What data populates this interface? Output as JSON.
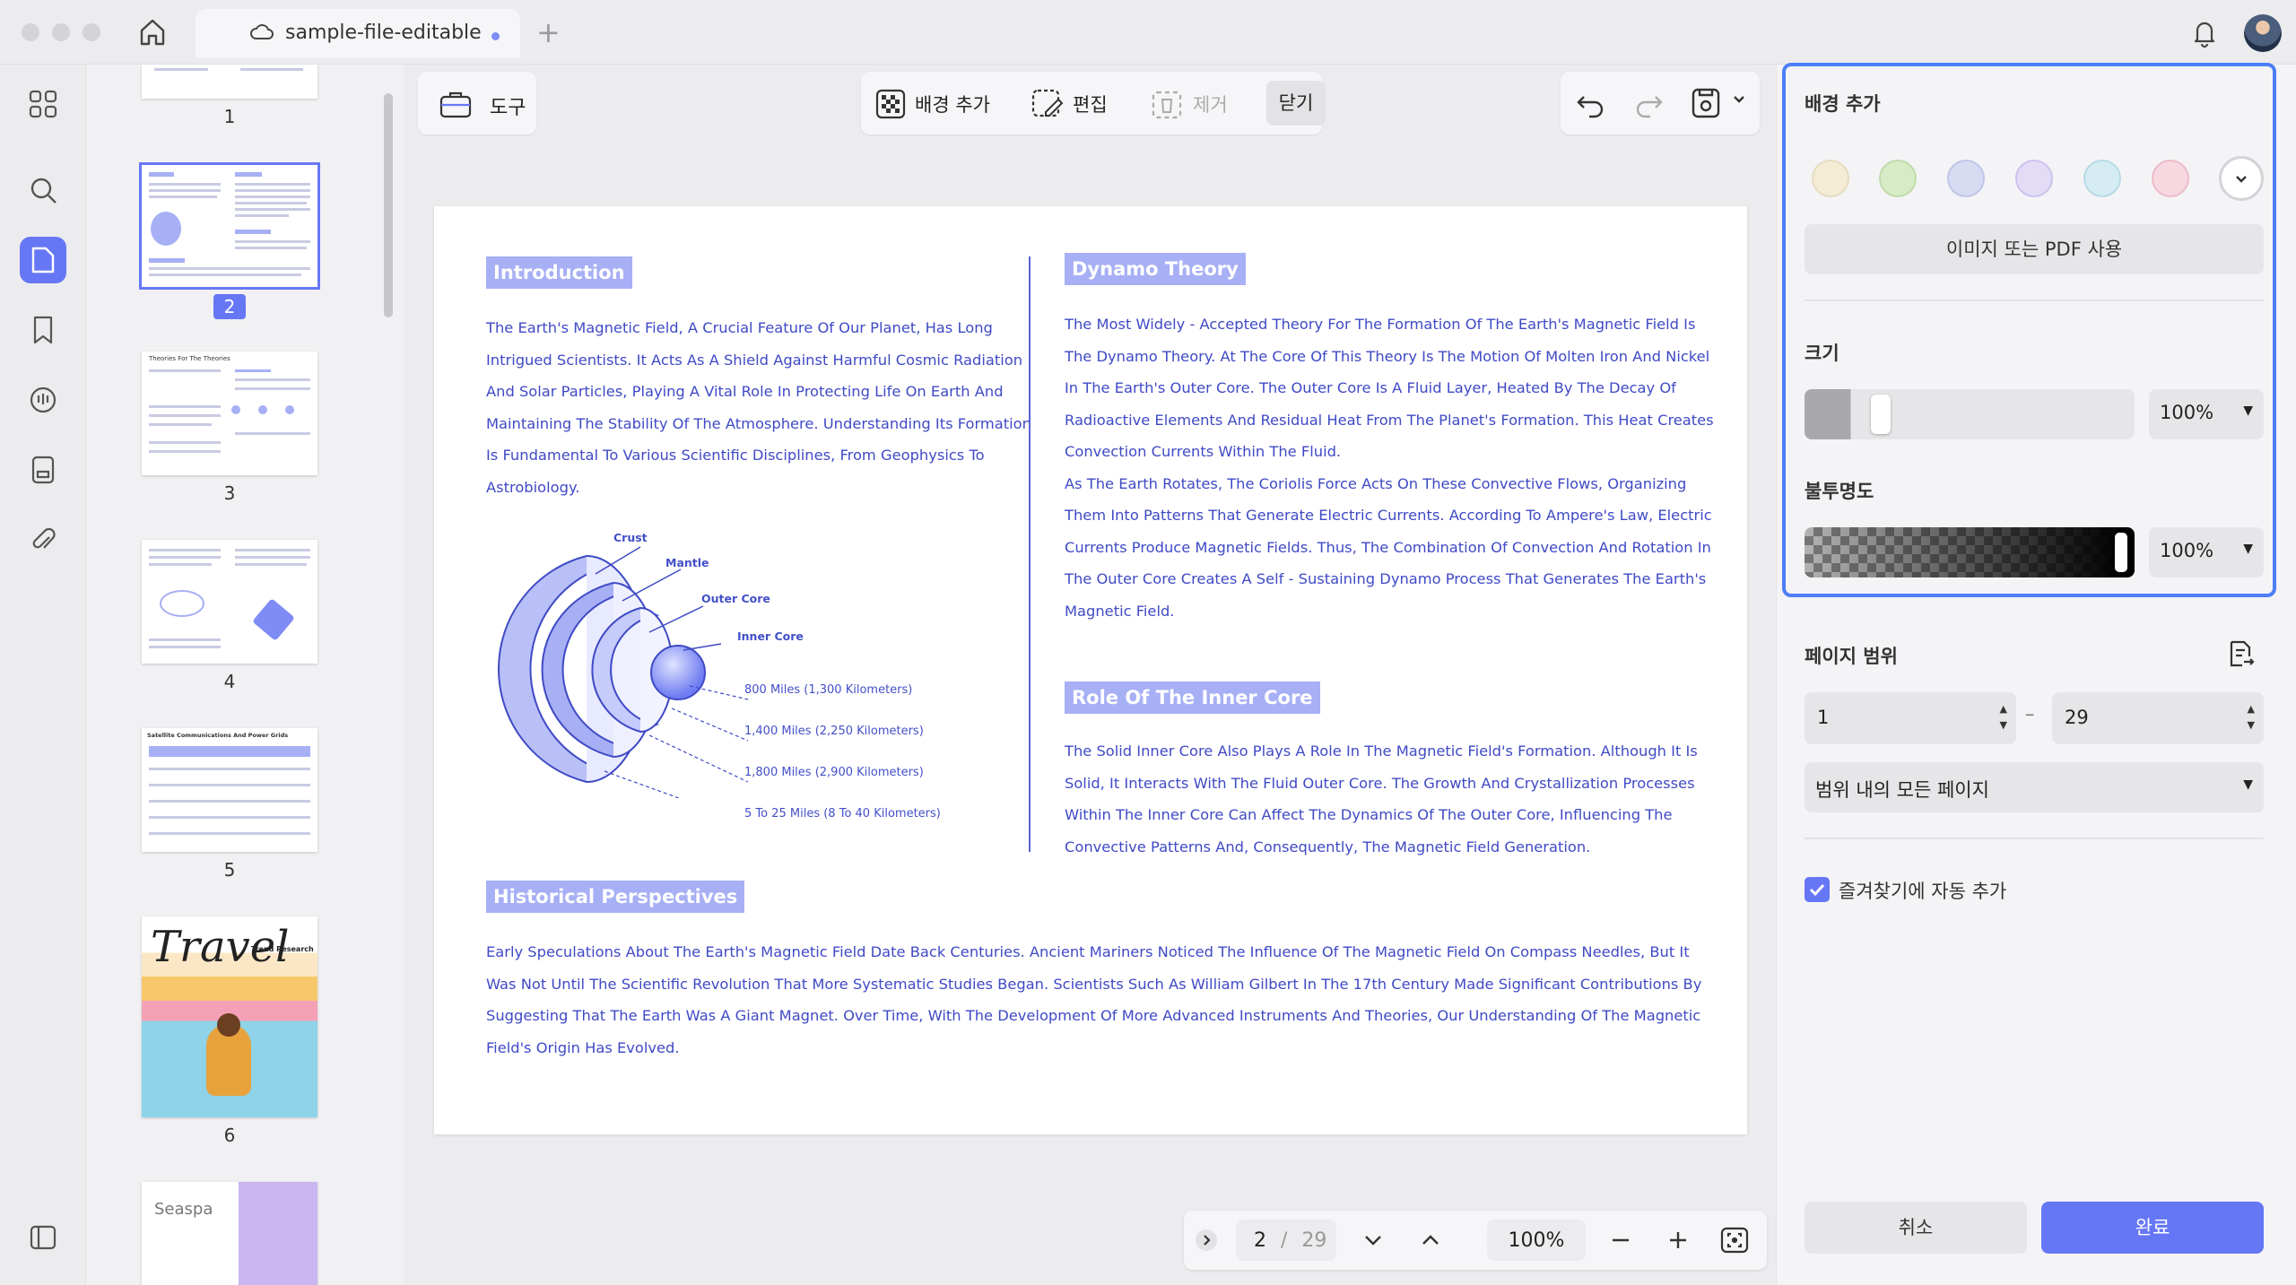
{
  "window": {
    "tab_title": "sample-file-editable",
    "new_tab_symbol": "+"
  },
  "thumbnails": {
    "pages": [
      "1",
      "2",
      "3",
      "4",
      "5",
      "6"
    ],
    "page3_title": "Theories For The Theories",
    "page5_title": "Satellite Communications And Power Grids",
    "page6_script": "Travel",
    "page6_caption": "Trend Research",
    "page7_word": "Seaspa"
  },
  "toolbar": {
    "tools_label": "도구",
    "add_background_label": "배경 추가",
    "edit_label": "편집",
    "remove_label": "제거",
    "close_label": "닫기"
  },
  "document": {
    "introduction": {
      "heading": "Introduction",
      "lines": [
        "The Earth's Magnetic Field, A Crucial Feature Of Our Planet, Has Long",
        "Intrigued Scientists. It Acts As A Shield Against Harmful Cosmic Radiation",
        "And Solar Particles, Playing A Vital Role In Protecting Life On Earth And",
        "Maintaining The Stability Of The Atmosphere. Understanding Its Formation",
        "Is Fundamental To Various Scientific Disciplines, From Geophysics To",
        "Astrobiology."
      ]
    },
    "earth_diagram": {
      "layers": [
        "Crust",
        "Mantle",
        "Outer Core",
        "Inner Core"
      ],
      "distances": [
        "800 Miles (1,300 Kilometers)",
        "1,400 Miles (2,250 Kilometers)",
        "1,800 Miles (2,900 Kilometers)",
        "5 To 25 Miles (8 To 40 Kilometers)"
      ]
    },
    "dynamo": {
      "heading": "Dynamo Theory",
      "lines": [
        "The Most Widely - Accepted Theory For The Formation Of The Earth's Magnetic Field Is",
        "The Dynamo Theory. At The Core Of This Theory Is The Motion Of Molten Iron And Nickel",
        "In The Earth's Outer Core. The Outer Core Is A Fluid Layer, Heated By The Decay Of",
        "Radioactive Elements And Residual Heat From The Planet's Formation. This Heat Creates",
        "Convection Currents Within The Fluid.",
        "As The Earth Rotates, The Coriolis Force Acts On These Convective Flows, Organizing",
        "Them Into Patterns That Generate Electric Currents. According To Ampere's Law, Electric",
        "Currents Produce Magnetic Fields. Thus, The Combination Of Convection And Rotation In",
        "The Outer Core Creates A Self - Sustaining Dynamo Process That Generates The Earth's",
        "Magnetic Field."
      ]
    },
    "inner_core": {
      "heading": "Role Of The Inner Core",
      "lines": [
        "The Solid Inner Core Also Plays A Role In The Magnetic Field's Formation. Although It Is",
        "Solid, It Interacts With The Fluid Outer Core. The Growth And Crystallization Processes",
        "Within The Inner Core Can Affect The Dynamics Of The Outer Core, Influencing The",
        "Convective Patterns And, Consequently, The Magnetic Field Generation."
      ]
    },
    "historical": {
      "heading": "Historical Perspectives",
      "lines": [
        "Early Speculations About The Earth's Magnetic Field Date Back Centuries. Ancient Mariners Noticed The Influence Of The Magnetic Field On Compass Needles, But It",
        "Was Not Until The Scientific Revolution That More Systematic Studies Began. Scientists Such As William Gilbert In The 17th Century Made Significant Contributions By",
        "Suggesting That The Earth Was A Giant Magnet. Over Time, With The Development Of More Advanced Instruments And Theories, Our Understanding Of The Magnetic",
        "Field's Origin Has Evolved."
      ]
    }
  },
  "navigation": {
    "current_page": "2",
    "separator": "/",
    "total_pages": "29",
    "zoom": "100%"
  },
  "panel": {
    "title": "배경 추가",
    "swatches": [
      "#f5ecd6",
      "#d6ecc6",
      "#d7dcf3",
      "#e3dcf6",
      "#d4ecf2",
      "#f7d7e0"
    ],
    "use_image_label": "이미지 또는 PDF 사용",
    "size_label": "크기",
    "size_value": "100%",
    "opacity_label": "불투명도",
    "opacity_value": "100%",
    "page_range_label": "페이지 범위",
    "range_from": "1",
    "range_dash": "–",
    "range_to": "29",
    "range_option": "범위 내의 모든 페이지",
    "bookmark_label": "즐겨찾기에 자동 추가",
    "cancel_label": "취소",
    "done_label": "완료",
    "accent": "#6677f5",
    "frame_color": "#4c7ef7"
  }
}
